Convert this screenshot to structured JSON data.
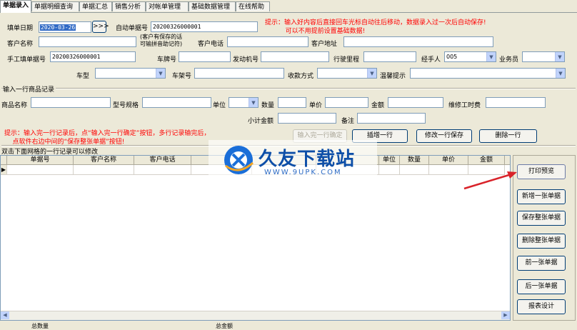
{
  "tabs": [
    "单据录入",
    "单据明细查询",
    "单据汇总",
    "销售分析",
    "对帐单管理",
    "基础数据管理",
    "在线帮助"
  ],
  "form": {
    "fill_date_label": "填单日期",
    "fill_date_value": "2020-03-26",
    "date_button": ">>>",
    "auto_no_label": "自动单据号",
    "auto_no_value": "20200326000001",
    "hint1": "提示：输入好内容后直接回车光标自动往后移动，数据录入过一次后自动保存!\n          可以不用提前设置基础数据!",
    "customer_name_label": "客户名称",
    "customer_note_label": "(客户有保存的话\n可输拼音助记符)",
    "customer_phone_label": "客户电话",
    "customer_address_label": "客户地址",
    "manual_no_label": "手工填单据号",
    "manual_no_value": "20200326000001",
    "plate_label": "车牌号",
    "engine_label": "发动机号",
    "mileage_label": "行驶里程",
    "handler_label": "经手人",
    "handler_value": "005",
    "salesman_label": "业务员",
    "car_type_label": "车型",
    "frame_label": "车架号",
    "payment_label": "收款方式",
    "tip_label": "温馨提示"
  },
  "item_section": {
    "title": "输入一行商品记录",
    "product_name_label": "商品名称",
    "spec_label": "型号规格",
    "unit_label": "单位",
    "qty_label": "数量",
    "price_label": "单价",
    "amount_label": "金额",
    "labor_label": "维修工时费",
    "subtotal_label": "小计金额",
    "remark_label": "备注",
    "hint2": "提示：输入完一行记录后，点“输入完一行确定”按钮，多行记录输完后，\n    点软件右边中间的“保存整张单据”按钮!",
    "btn_confirm_row": "输入完一行确定",
    "btn_insert_row": "插增一行",
    "btn_modify_save": "修改一行保存",
    "btn_delete_row": "删除一行"
  },
  "grid": {
    "caption": "双击下面网格的一行记录可以修改",
    "columns": [
      "单据号",
      "客户名称",
      "客户电话",
      "",
      "",
      "",
      "单位",
      "数量",
      "单价",
      "金额"
    ]
  },
  "side_buttons": [
    "打印预览",
    "新增一张单据",
    "保存整张单据",
    "删除整张单据",
    "前一张单据",
    "后一张单据",
    "报表设计"
  ],
  "watermark": {
    "brand": "久友下载站",
    "url": "WWW.9UPK.COM"
  },
  "footer": [
    "总数量",
    "总金额"
  ],
  "colors": {
    "hint_red": "#ff0000",
    "date_highlight": "#316ac5",
    "arrow_red": "#d9232a"
  }
}
